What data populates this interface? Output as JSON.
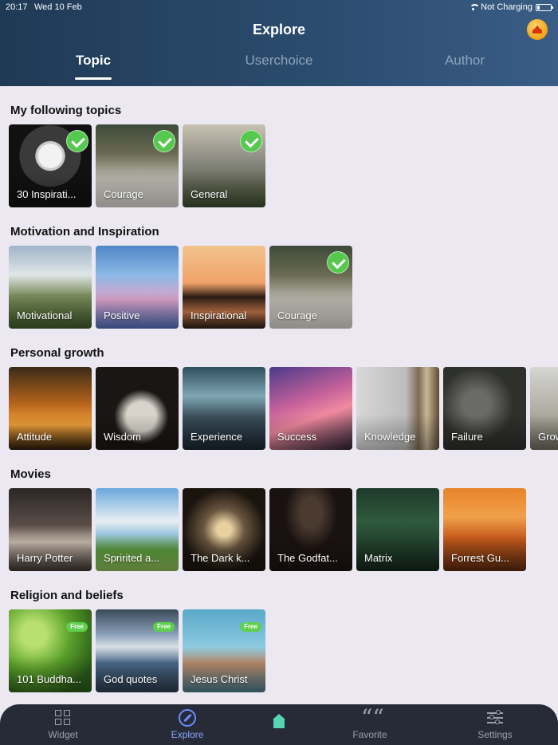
{
  "status_bar": {
    "time": "20:17",
    "date": "Wed 10 Feb",
    "battery": "Not Charging"
  },
  "header": {
    "title": "Explore"
  },
  "tabs": [
    {
      "label": "Topic",
      "active": true
    },
    {
      "label": "Userchoice",
      "active": false
    },
    {
      "label": "Author",
      "active": false
    }
  ],
  "sections": [
    {
      "title": "My following topics",
      "cards": [
        {
          "label": "30 Inspirati...",
          "checked": true,
          "free": false
        },
        {
          "label": "Courage",
          "checked": true,
          "free": false
        },
        {
          "label": "General",
          "checked": true,
          "free": false
        }
      ]
    },
    {
      "title": "Motivation and Inspiration",
      "cards": [
        {
          "label": "Motivational",
          "checked": false,
          "free": false
        },
        {
          "label": "Positive",
          "checked": false,
          "free": false
        },
        {
          "label": "Inspirational",
          "checked": false,
          "free": false
        },
        {
          "label": "Courage",
          "checked": true,
          "free": false
        }
      ]
    },
    {
      "title": "Personal growth",
      "cards": [
        {
          "label": "Attitude",
          "checked": false,
          "free": false
        },
        {
          "label": "Wisdom",
          "checked": false,
          "free": false
        },
        {
          "label": "Experience",
          "checked": false,
          "free": false
        },
        {
          "label": "Success",
          "checked": false,
          "free": false
        },
        {
          "label": "Knowledge",
          "checked": false,
          "free": false
        },
        {
          "label": "Failure",
          "checked": false,
          "free": false
        },
        {
          "label": "Grow",
          "checked": false,
          "free": false
        }
      ]
    },
    {
      "title": "Movies",
      "cards": [
        {
          "label": "Harry Potter",
          "checked": false,
          "free": false
        },
        {
          "label": "Spririted a...",
          "checked": false,
          "free": false
        },
        {
          "label": "The Dark k...",
          "checked": false,
          "free": false
        },
        {
          "label": "The Godfat...",
          "checked": false,
          "free": false
        },
        {
          "label": "Matrix",
          "checked": false,
          "free": false
        },
        {
          "label": "Forrest Gu...",
          "checked": false,
          "free": false
        }
      ]
    },
    {
      "title": "Religion and beliefs",
      "cards": [
        {
          "label": "101 Buddha...",
          "checked": false,
          "free": true
        },
        {
          "label": "God quotes",
          "checked": false,
          "free": true
        },
        {
          "label": "Jesus Christ",
          "checked": false,
          "free": true
        }
      ]
    }
  ],
  "free_badge": "Free",
  "bottom_nav": [
    {
      "label": "Widget",
      "icon": "widget-icon",
      "active": false
    },
    {
      "label": "Explore",
      "icon": "compass-icon",
      "active": true
    },
    {
      "label": "",
      "icon": "home-icon",
      "active": false
    },
    {
      "label": "Favorite",
      "icon": "quote-icon",
      "active": false
    },
    {
      "label": "Settings",
      "icon": "sliders-icon",
      "active": false
    }
  ],
  "colors": {
    "header_start": "#1f3a55",
    "header_end": "#3a5d86",
    "background": "#ebe8f1",
    "check": "#55c84e",
    "nav_bg": "#262b37",
    "nav_active": "#8aa4ff",
    "home": "#57d4b0"
  }
}
